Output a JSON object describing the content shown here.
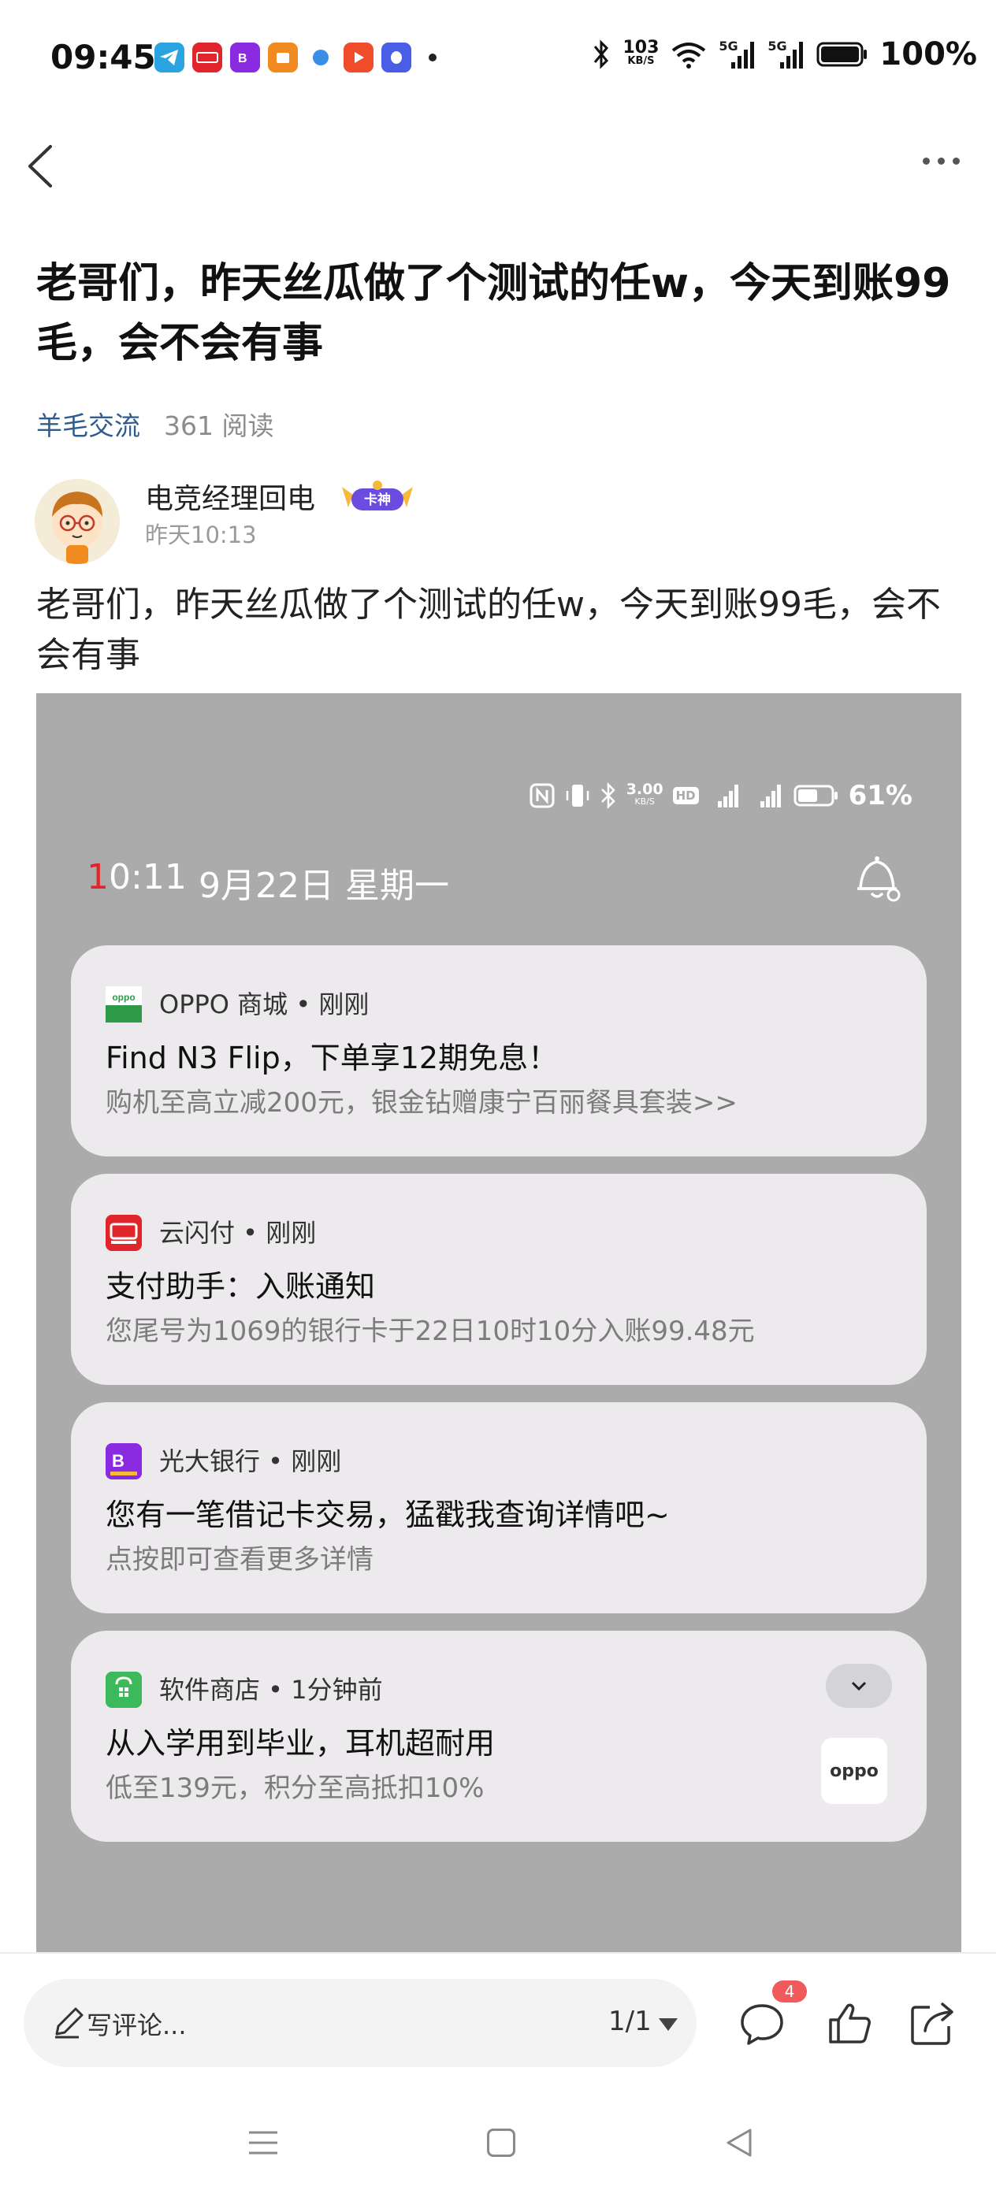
{
  "status_bar": {
    "time": "09:45",
    "net_speed_value": "103",
    "net_speed_unit": "KB/S",
    "signal_1": "5G",
    "signal_2": "5G",
    "battery": "100%",
    "app_icons": [
      "telegram-icon",
      "yunshanfu-icon",
      "bank-icon",
      "taobao-icon",
      "browser-icon",
      "video-icon",
      "qq-icon"
    ]
  },
  "post": {
    "title": "老哥们，昨天丝瓜做了个测试的任w，今天到账99毛，会不会有事",
    "category": "羊毛交流",
    "reads": "361 阅读",
    "author": "电竞经理回电",
    "badge": "卡神",
    "time": "昨天10:13",
    "body": "老哥们，昨天丝瓜做了个测试的任w，今天到账99毛，会不会有事"
  },
  "screenshot": {
    "status": {
      "speed_value": "3.00",
      "speed_unit": "KB/S",
      "hd": "HD",
      "battery": "61%"
    },
    "time_first": "1",
    "time_rest": "0:11",
    "date": "9月22日 星期一",
    "notifications": [
      {
        "app": "OPPO 商城",
        "when": "刚刚",
        "source": "OPPO 商城 • 刚刚",
        "title": "Find N3 Flip，下单享12期免息！",
        "body": "购机至高立减200元，银金钻赠康宁百丽餐具套装>>",
        "icon": "oppo-store-icon",
        "icon_color": "#2e9b4a"
      },
      {
        "app": "云闪付",
        "when": "刚刚",
        "source": "云闪付 • 刚刚",
        "title": "支付助手：入账通知",
        "body": "您尾号为1069的银行卡于22日10时10分入账99.48元",
        "icon": "yunshanfu-icon",
        "icon_color": "#e0262b"
      },
      {
        "app": "光大银行",
        "when": "刚刚",
        "source": "光大银行 • 刚刚",
        "title": "您有一笔借记卡交易，猛戳我查询详情吧~",
        "body": "点按即可查看更多详情",
        "icon": "everbright-bank-icon",
        "icon_color": "#8a2be2"
      },
      {
        "app": "软件商店",
        "when": "1分钟前",
        "source": "软件商店 • 1分钟前",
        "title": "从入学用到毕业，耳机超耐用",
        "body": "低至139元，积分至高抵扣10%",
        "icon": "app-store-icon",
        "icon_color": "#3cb95a",
        "thumb_text": "oppo"
      }
    ]
  },
  "bottom_bar": {
    "comment_placeholder": "写评论...",
    "pages": "1/1",
    "comment_count": "4"
  }
}
